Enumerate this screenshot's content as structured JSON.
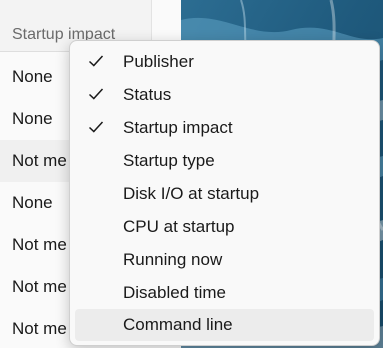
{
  "column_header": {
    "label": "Startup impact"
  },
  "rows": [
    {
      "value": "None"
    },
    {
      "value": "None"
    },
    {
      "value": "Not me"
    },
    {
      "value": "None"
    },
    {
      "value": "Not me"
    },
    {
      "value": "Not me"
    },
    {
      "value": "Not me"
    }
  ],
  "context_menu": {
    "items": [
      {
        "label": "Publisher",
        "checked": true
      },
      {
        "label": "Status",
        "checked": true
      },
      {
        "label": "Startup impact",
        "checked": true
      },
      {
        "label": "Startup type",
        "checked": false
      },
      {
        "label": "Disk I/O at startup",
        "checked": false
      },
      {
        "label": "CPU at startup",
        "checked": false
      },
      {
        "label": "Running now",
        "checked": false
      },
      {
        "label": "Disabled time",
        "checked": false
      },
      {
        "label": "Command line",
        "checked": false,
        "hovered": true
      }
    ]
  }
}
